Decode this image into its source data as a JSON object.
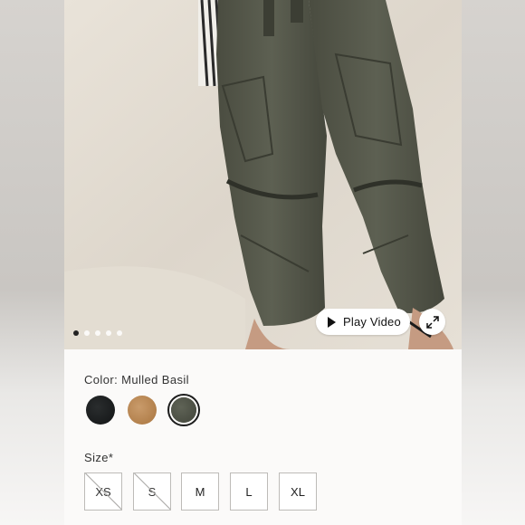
{
  "gallery": {
    "active_index": 0,
    "dots": [
      true,
      false,
      false,
      false,
      false
    ],
    "play_video_label": "Play Video"
  },
  "product": {
    "color_label": "Color: Mulled Basil",
    "swatches": [
      {
        "name": "black",
        "color": "#1b1e1f",
        "selected": false
      },
      {
        "name": "tan",
        "color": "#b8844f",
        "selected": false
      },
      {
        "name": "mulled-basil",
        "color": "#4f5247",
        "selected": true
      }
    ],
    "size_label": "Size*",
    "sizes": [
      {
        "label": "XS",
        "available": false
      },
      {
        "label": "S",
        "available": false
      },
      {
        "label": "M",
        "available": true
      },
      {
        "label": "L",
        "available": true
      },
      {
        "label": "XL",
        "available": true
      }
    ]
  }
}
